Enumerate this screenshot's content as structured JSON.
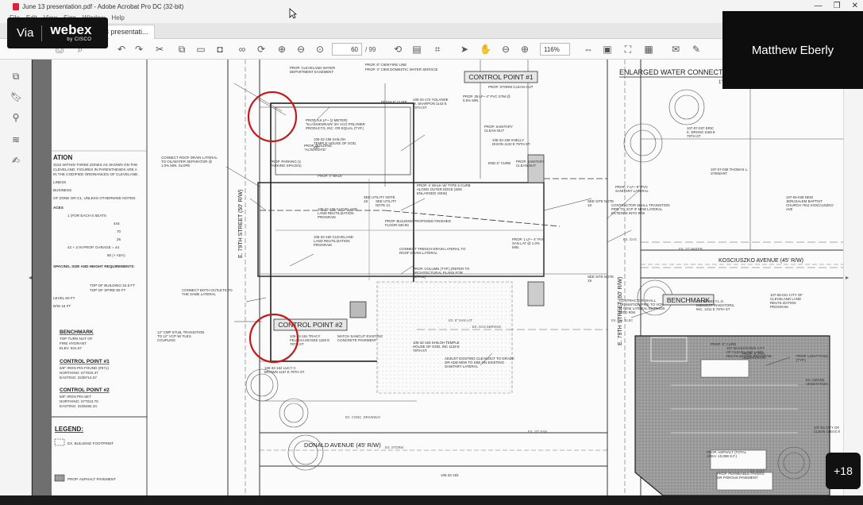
{
  "window": {
    "title": "June 13 presentation.pdf - Adobe Acrobat Pro DC (32-bit)",
    "menu": [
      "File",
      "Edit",
      "View",
      "Sign",
      "Window",
      "Help"
    ],
    "controls": [
      "—",
      "❐",
      "✕"
    ]
  },
  "tabs": [
    {
      "label": "3 presentati..."
    }
  ],
  "toolbar": {
    "page_current": "60",
    "page_total": "/ 99",
    "zoom": "116%"
  },
  "webex": {
    "via": "Via",
    "brand": "webex",
    "sub": "by CISCO"
  },
  "speaker": {
    "name": "Matthew Eberly"
  },
  "participants_more": "+18",
  "drawing": {
    "control_point_1": "CONTROL POINT #1",
    "control_point_2": "CONTROL POINT #2",
    "benchmark_tag": "BENCHMARK",
    "enlarged_title": "ENLARGED WATER CONNECT",
    "enlarged_scale": "1\" = 5'",
    "street_east": "E. 79TH STREET (60' R/W)",
    "street_west": "E. 79TH STREET (50' R/W)",
    "kosciuszko": "KOSCIUSZKO AVENUE (45' R/W)",
    "donald": "DONALD AVENUE (45' R/W)",
    "ration": "ATION",
    "legend": "LEGEND:",
    "legend_items": [
      "EX. BUILDING FOOTPRINT",
      "PROP. ASPHALT PAVEMENT"
    ],
    "left_notes": [
      "3152 WITHIN THREE ZONES AS SHOWN ON THE",
      "CLEVELAND. FIGURES IN PARENTHESES ARE A",
      "IN THE CODIFIED ORDINANCES OF CLEVELAND.",
      "LINESS",
      "BUSINESS",
      "OF ZONE GR-C1, UNLESS OTHERWISE NOTED.",
      "ACES",
      "1 (FOR EACH 6 SEATS",
      "444",
      "70",
      "26",
      "42 + 2 IN PROP. GARAGE = 44",
      "80 (+ ADA)"
    ],
    "height_req": "SPACING, SIZE AND HEIGHT REQUIREMENTS:",
    "height_rows": [
      "TOP OF BUILDING  34.5 FT",
      "TOP OF SPIRE     80 FT",
      "LEVEL  60 FT",
      "R/W   15 FT"
    ],
    "benchmark_head": "BENCHMARK",
    "benchmark_text": [
      "TOP TURN NUT OF",
      "FIRE HYDRANT",
      "ELEV. 631.67"
    ],
    "cp1_head": "CONTROL POINT #1",
    "cp1_text": [
      "5/8\" IRON PIN FOUND (#971)",
      "NORTHING: 677020.37",
      "EASTING: 2235714.57"
    ],
    "cp2_head": "CONTROL POINT #2",
    "cp2_text": [
      "5/8\" IRON PIN SET",
      "NORTHING: 677010.70",
      "EASTING: 2235484.34"
    ],
    "callouts": [
      "PROP. CLEVELAND WATER DEPARTMENT EASEMENT",
      "PROP. 8\" C909 FIRE LINE",
      "PROP. 4\" C900 DOMESTIC WATER SERVICE",
      "PROP. STORM CLEAN OUT",
      "PROP. 35 LF~ 4\" PVC STM @ 0.5% MIN.",
      "PROP. 5.6 LF~ (2 METER) \"KLASSIKDRAIN\" BY ACO POLYMER PRODUCTS, INC. OR EQUAL (TYP.)",
      "PROP. BUILDING \"ALTERNATE\"",
      "CONNECT ROOF DRAIN LATERAL TO OIL/WATER SEPARATOR @ 1.0% MIN. SLOPE",
      "PROP. PARKING (2 PARKING SPACES)",
      "PROP. 4' WALK",
      "SEE UTILITY NOTE 21",
      "PROP. 4' WALK W/ TYPE 6 CURB ALONG OUTER EDGE (SEE ENLARGED VIEW)",
      "PROP. BUILDING PROPOSED FINISHED FLOOR 630.90",
      "PROP. 7 LF~ 8\" PVC SANITARY LATERAL",
      "CONTRACTOR SHALL TRANSITION PIPE TO VCP IF NEW LATERAL EXTENDS INTO R/W",
      "CONNECT TRENCH DRAIN LATERAL TO ROOF DRAIN LATERAL",
      "PROP. COLUMN (TYP.) (REFER TO ARCHITECTURAL PLANS FOR DETAIL)",
      "CONNECT BOTH OUTLETS TO THE SAME LATERAL",
      "12\" CMP STUB, TRANSITION TO 12\" VCP W/ FLEX. COUPLING",
      "MATCH SAWCUT EXISTING CONCRETE PAVEMENT",
      "ADJUST EXISTING CLEANOUT TO GRADE OR ADD NEW TO SEE ON EXISTING SANITARY LATERAL",
      "CONTRACTOR SHALL TRANSITION PIPE TO VCP IF NEW LATERAL EXTENDS INTO R/W",
      "PROP. 6\" CURB",
      "PROP. 4\" PVC UNDERDRAIN",
      "PROP. ASPHALT (TOTAL AREA: 10,099 S.F.)",
      "PROP. PERMEABLE PAVERS OR POROUS PAVEMENT",
      "PROP. LIGHT POLE (TYP.)",
      "EX. DENSE VEGETATION",
      "BEGIN 6\" CURB",
      "END 6\" CURB",
      "PROP. SANITARY CLEAN OUT",
      "PROP. 1 LF~ 4\" PVC SAN LAT @ 1.0% MIN.",
      "PROP. SANITARY CLEAN OUT",
      "SEE UTILITY NOTE 18",
      "SEE SITE NOTE 19",
      "SEE SITE NOTE 18"
    ],
    "parcels": [
      "105-32-172 YOLANDE M. SHARPON 1143 E 79TH ST",
      "105-32-169 SHELLY DIXON 1132 E 79TH ST",
      "105-32-158 SHILOH TEMPLE HOUSE OF GOD, INC",
      "105-32-159 CLEVELAND LAND REUTILIZATION PROGRAM",
      "105-32-160 CLEVELAND LAND REUTILIZATION PROGRAM",
      "105-32-161 TRACY FELECIA MCGEE 1160 E 79TH ST",
      "105-32-162 LUCY C BROWN 1167 E 79TH ST",
      "105-32-163 SHILOH TEMPLE HOUSE OF GOD, INC 1128 E 79TH ST",
      "107-07-037 ERIC K. DROSS 1159 E 79TH ST",
      "107-07-038 THOMAS L. STEWART",
      "107-06-038 NEW JERUSALEM BAPTIST CHURCH 7911 KOSCIUSZKO AVE",
      "107-06-001 T.L.G. MIDWEST INVESTORS, INC. 1211 E 79TH ST",
      "107-06-021 CITY OF CLEVELAND LAND REUTILIZATION PROGRAM",
      "107-06-022/3/4/5/6 CITY OF CLEVELAND LAND REUTILIZATION PROGRAM",
      "107-06 CITY OF CLEVE 1184 E 8",
      "105-32-183"
    ],
    "misc_labels": [
      "EX. GAS",
      "EX. 12\" WATER",
      "EX. 8\" SAN LAT",
      "EX. CONC. DRIVEWAY",
      "EX. GAS SERVICE",
      "EX. OH. ELEC",
      "EX. STORM",
      "EX. 10\" SAN",
      "EX. ELEC"
    ]
  }
}
